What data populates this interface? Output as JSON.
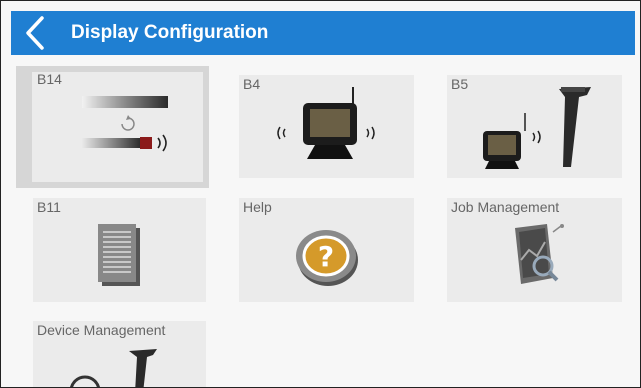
{
  "header": {
    "title": "Display Configuration",
    "back_icon": "chevron-left-icon",
    "color": "#1f7fd2"
  },
  "tiles": [
    {
      "label": "B14",
      "icon": "b14-sensor-icon",
      "selected": true
    },
    {
      "label": "B4",
      "icon": "wireless-display-icon",
      "selected": false
    },
    {
      "label": "B5",
      "icon": "display-and-locator-icon",
      "selected": false
    },
    {
      "label": "B11",
      "icon": "document-icon",
      "selected": false
    },
    {
      "label": "Help",
      "icon": "help-icon",
      "selected": false
    },
    {
      "label": "Job Management",
      "icon": "job-management-icon",
      "selected": false
    },
    {
      "label": "Device Management",
      "icon": "device-management-icon",
      "selected": false
    }
  ]
}
